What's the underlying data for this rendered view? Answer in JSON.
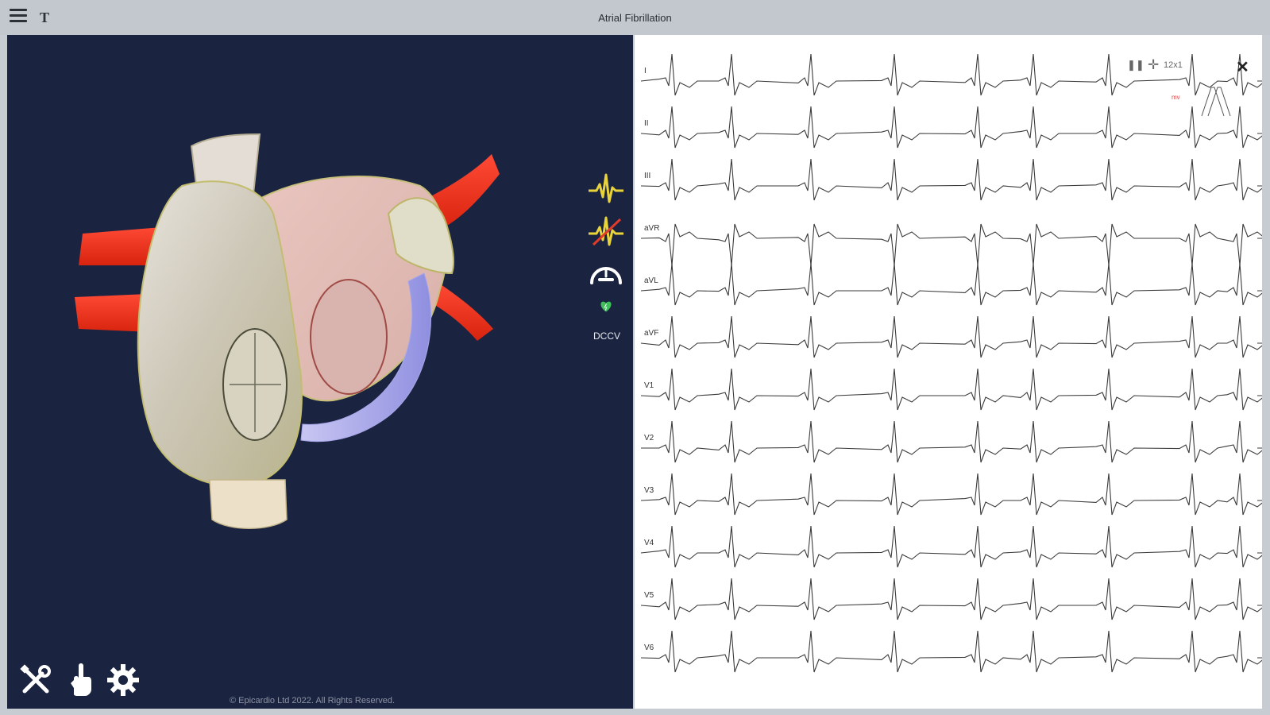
{
  "header": {
    "title": "Atrial Fibrillation",
    "menu_icon": "hamburger-menu-icon",
    "text_tool_label": "T"
  },
  "viewer": {
    "background": "#1a2440",
    "side_tools": [
      {
        "name": "ecg-lead-icon",
        "color": "#e9d33a"
      },
      {
        "name": "ecg-lead-off-icon",
        "color": "#e9d33a"
      },
      {
        "name": "gauge-icon",
        "color": "#ffffff"
      },
      {
        "name": "defibrillator-heart-icon",
        "color": "#3fbf5a"
      }
    ],
    "dccv_label": "DCCV",
    "bottom_tools": [
      {
        "name": "tools-icon"
      },
      {
        "name": "hand-pointer-icon"
      },
      {
        "name": "settings-gear-icon"
      }
    ],
    "copyright": "© Epicardio Ltd 2022. All Rights Reserved."
  },
  "ecg": {
    "leads": [
      "I",
      "II",
      "III",
      "aVR",
      "aVL",
      "aVF",
      "V1",
      "V2",
      "V3",
      "V4",
      "V5",
      "V6"
    ],
    "controls": {
      "pause_icon": "pause-icon",
      "calipers_icon": "calipers-icon",
      "layout_label": "12x1",
      "close_icon": "close-icon"
    },
    "inset_label": "mv"
  }
}
